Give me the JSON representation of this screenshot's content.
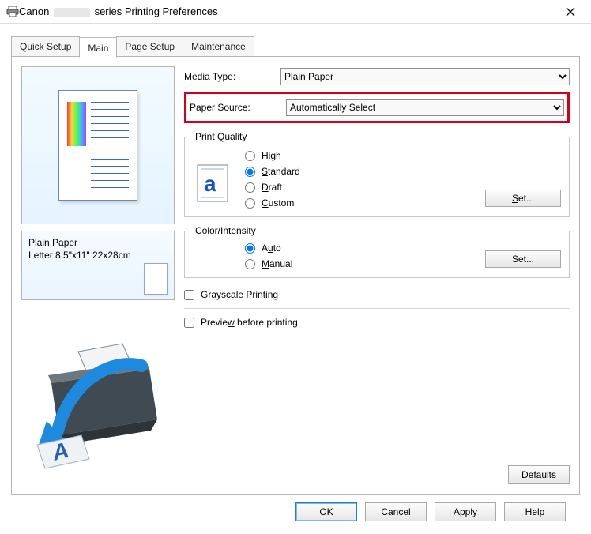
{
  "window": {
    "title_prefix": "Canon",
    "title_suffix": "series Printing Preferences"
  },
  "tabs": [
    {
      "label": "Quick Setup"
    },
    {
      "label": "Main"
    },
    {
      "label": "Page Setup"
    },
    {
      "label": "Maintenance"
    }
  ],
  "left": {
    "media_line": "Plain Paper",
    "size_line": "Letter 8.5\"x11\" 22x28cm"
  },
  "main": {
    "media_type_label": "Media Type:",
    "media_type_value": "Plain Paper",
    "paper_source_label": "Paper Source:",
    "paper_source_value": "Automatically Select",
    "print_quality_legend": "Print Quality",
    "quality": {
      "high": "High",
      "standard": "Standard",
      "draft": "Draft",
      "custom": "Custom"
    },
    "set_label": "Set...",
    "color_intensity_legend": "Color/Intensity",
    "ci": {
      "auto": "Auto",
      "manual": "Manual"
    },
    "grayscale_label": "Grayscale Printing",
    "preview_label": "Preview before printing",
    "defaults_label": "Defaults"
  },
  "buttons": {
    "ok": "OK",
    "cancel": "Cancel",
    "apply": "Apply",
    "help": "Help"
  }
}
